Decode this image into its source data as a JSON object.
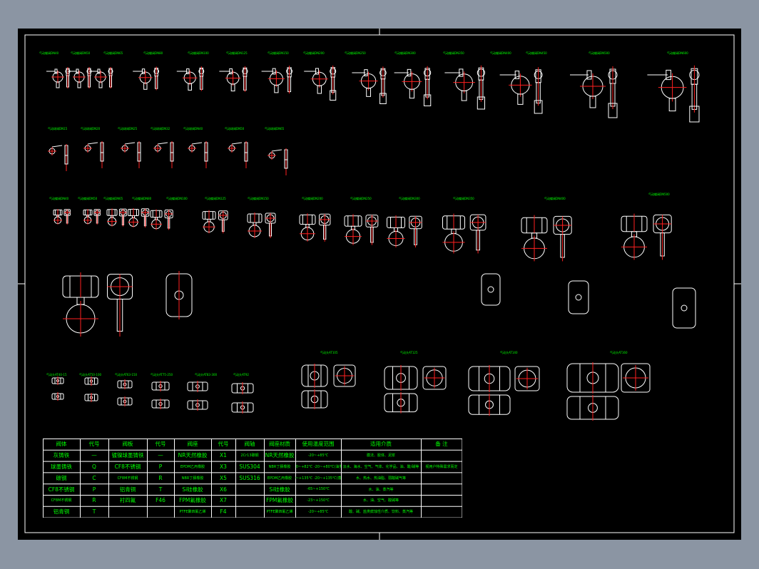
{
  "labels": {
    "row1": [
      "气动蝶阀DN40",
      "气动蝶阀DN50",
      "气动蝶阀DN65",
      "气动蝶阀DN80",
      "气动蝶阀DN100",
      "气动蝶阀DN125",
      "气动蝶阀DN150",
      "气动蝶阀DN200",
      "气动蝶阀DN250",
      "气动蝶阀DN300",
      "气动蝶阀DN350",
      "气动蝶阀DN400",
      "气动蝶阀DN450",
      "气动蝶阀DN500",
      "气动蝶阀DN600",
      "气动蝶阀DN700"
    ],
    "row2": [
      "气动球阀DN15",
      "气动球阀DN20",
      "气动球阀DN25",
      "气动球阀DN32",
      "气动球阀DN40",
      "气动球阀DN50",
      "气动球阀DN65"
    ],
    "row3": [
      "气动蝶阀DN40",
      "气动蝶阀DN50",
      "气动蝶阀DN65",
      "气动蝶阀DN80",
      "气动蝶阀DN100",
      "气动蝶阀DN125",
      "气动蝶阀DN150",
      "气动蝶阀DN200",
      "气动蝶阀DN250",
      "气动蝶阀DN300",
      "气动蝶阀DN350",
      "气动蝶阀DN400"
    ],
    "row3b": "气动蝶阀DN500",
    "row4_small": [
      "气动头AT40-15",
      "气动头AT50-100",
      "气动头AT63-150",
      "气动头AT75-250",
      "气动头AT83-300",
      "气动头AT92"
    ],
    "row4_large": [
      "气动头AT105",
      "气动头AT125",
      "气动头AT140",
      "气动头AT160"
    ]
  },
  "table": {
    "headers": [
      "阀体",
      "代号",
      "阀板",
      "代号",
      "阀座",
      "代号",
      "阀轴",
      "阀座材质",
      "使用温度范围",
      "适用介质",
      "备  注"
    ],
    "rows": [
      [
        "灰铸铁",
        "—",
        "镀镍球墨铸铁",
        "—",
        "NR天然橡胶",
        "X1",
        "2Cr13碳钢",
        "NR天然橡胶",
        "-20~+85℃",
        "膜法、胶体、泥浆",
        "",
        ""
      ],
      [
        "球墨铸铁",
        "Q",
        "CF8不锈钢",
        "P",
        "EPDM乙丙橡胶",
        "X3",
        "SUS304",
        "NBR丁腈橡胶",
        "-10~+82℃\n-20~+80℃(油类)",
        "淡水、海水、空气、气体、化学品、油、酸/碱等",
        "视用户特殊需求而定",
        ""
      ],
      [
        "碳钢",
        "C",
        "CF8M不锈钢",
        "R",
        "NBR丁腈橡胶",
        "X5",
        "SUS316",
        "EPDM乙丙橡胶",
        "-40~+135℃\n-20~+135℃(蒸汽)",
        "水、热水、热油脂、弱酸碱气等",
        ""
      ],
      [
        "CF8不锈钢",
        "P",
        "铝青铜",
        "T",
        "Si硅橡胶",
        "X6",
        "",
        "Si硅橡胶",
        "-65~+150℃",
        "水、油、蒸汽等",
        ""
      ],
      [
        "CF8M不锈钢",
        "R",
        "衬四氟",
        "F46",
        "FPM氟橡胶",
        "X7",
        "",
        "FPM氟橡胶",
        "-23~+150℃",
        "水、油、空气、酸碱等",
        ""
      ],
      [
        "铝青铜",
        "T",
        "",
        "",
        "PTFE聚四氟乙烯",
        "F4",
        "",
        "PTFE聚四氟乙烯",
        "-20~+85℃",
        "酸、碱、盐类腐蚀性介质、饮料、蒸汽等",
        ""
      ]
    ]
  }
}
